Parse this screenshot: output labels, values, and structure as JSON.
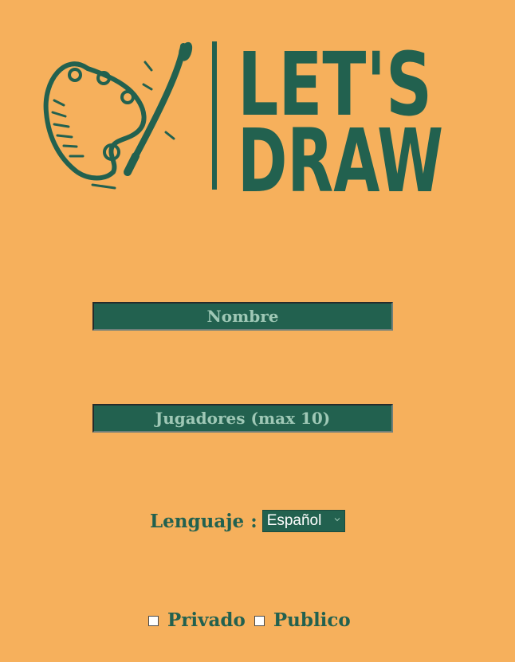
{
  "logo": {
    "line1": "LET'S",
    "line2": "DRAW",
    "icon": "paint-palette-icon"
  },
  "form": {
    "nombre_placeholder": "Nombre",
    "nombre_value": "",
    "jugadores_placeholder": "Jugadores (max 10)",
    "jugadores_value": ""
  },
  "language": {
    "label": "Lenguaje :",
    "selected": "Español"
  },
  "visibility": {
    "privado_label": "Privado",
    "privado_checked": false,
    "publico_label": "Publico",
    "publico_checked": false
  },
  "colors": {
    "background": "#F6B05C",
    "primary": "#22614F",
    "placeholder": "#9FC8B6"
  }
}
